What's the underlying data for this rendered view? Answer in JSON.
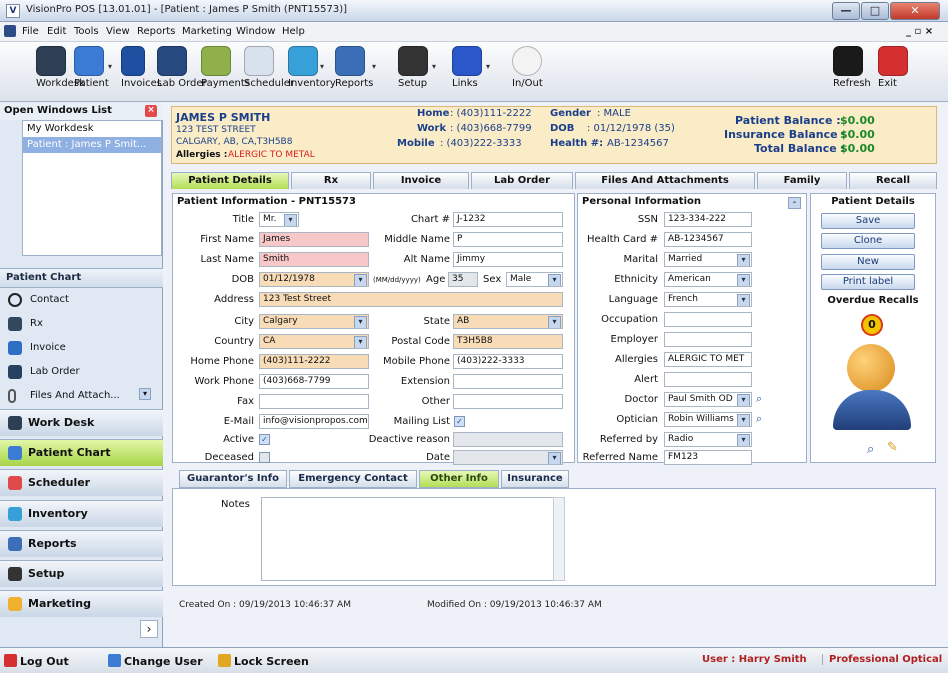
{
  "window": {
    "title": "VisionPro POS   [13.01.01] - [Patient : James P Smith (PNT15573)]",
    "logo": "V",
    "min": "—",
    "max": "□",
    "close": "✕"
  },
  "menu": {
    "items": [
      "File",
      "Edit",
      "Tools",
      "View",
      "Reports",
      "Marketing",
      "Window",
      "Help"
    ],
    "controls": "_ ▫ ×"
  },
  "toolbar": {
    "items": [
      {
        "label": "Workdesk",
        "icon": "workdesk-icon",
        "color": "#2e3f55"
      },
      {
        "label": "Patient",
        "icon": "patient-icon",
        "color": "#3b7bd4"
      },
      {
        "label": "Invoices",
        "icon": "invoices-icon",
        "color": "#1f4fa0"
      },
      {
        "label": "Lab Order",
        "icon": "lab-order-icon",
        "color": "#264a7f"
      },
      {
        "label": "Payments",
        "icon": "payments-icon",
        "color": "#8fb04a"
      },
      {
        "label": "Scheduler",
        "icon": "scheduler-icon",
        "color": "#d8e2ef"
      },
      {
        "label": "Inventory",
        "icon": "inventory-icon",
        "color": "#38a0d8"
      },
      {
        "label": "Reports",
        "icon": "reports-icon",
        "color": "#3a6fb8"
      },
      {
        "label": "Setup",
        "icon": "setup-icon",
        "color": "#333333"
      },
      {
        "label": "Links",
        "icon": "links-icon",
        "color": "#2a57c9"
      },
      {
        "label": "In/Out",
        "icon": "in-out-icon",
        "color": "#f3f3f3"
      },
      {
        "label": "Refresh",
        "icon": "refresh-icon",
        "color": "#1a1a1a"
      },
      {
        "label": "Exit",
        "icon": "exit-icon",
        "color": "#d43030"
      }
    ],
    "dropdown": "▾"
  },
  "left": {
    "open_windows_title": "Open Windows List",
    "open_windows": [
      "My Workdesk",
      "Patient : James P Smit..."
    ],
    "patient_chart_title": "Patient Chart",
    "chart_items": [
      {
        "label": "Contact",
        "icon": "contact-icon"
      },
      {
        "label": "Rx",
        "icon": "rx-icon"
      },
      {
        "label": "Invoice",
        "icon": "invoice-icon"
      },
      {
        "label": "Lab Order",
        "icon": "lab-order-icon"
      },
      {
        "label": "Files And Attach...",
        "icon": "paperclip-icon"
      }
    ],
    "nav": [
      {
        "label": "Work Desk",
        "icon": "workdesk-icon"
      },
      {
        "label": "Patient Chart",
        "icon": "patient-chart-icon"
      },
      {
        "label": "Scheduler",
        "icon": "scheduler-icon"
      },
      {
        "label": "Inventory",
        "icon": "inventory-icon"
      },
      {
        "label": "Reports",
        "icon": "reports-icon"
      },
      {
        "label": "Setup",
        "icon": "setup-icon"
      },
      {
        "label": "Marketing",
        "icon": "marketing-icon"
      }
    ],
    "expand": "›"
  },
  "header": {
    "name": "JAMES P SMITH",
    "street": "123 TEST STREET",
    "city": "CALGARY, AB, CA,T3H5B8",
    "allergies_label": "Allergies :",
    "allergies_value": "ALERGIC TO METAL",
    "home_label": "Home",
    "home": ": (403)111-2222",
    "work_label": "Work",
    "work": ": (403)668-7799",
    "mobile_label": "Mobile",
    "mobile": ": (403)222-3333",
    "gender_label": "Gender",
    "gender": ": MALE",
    "dob_label": "DOB",
    "dob": ": 01/12/1978 (35)",
    "health_label": "Health #:",
    "health": "AB-1234567",
    "patient_balance_label": "Patient Balance :",
    "patient_balance": "$0.00",
    "insurance_balance_label": "Insurance Balance :",
    "insurance_balance": "$0.00",
    "total_balance_label": "Total Balance :",
    "total_balance": "$0.00"
  },
  "tabs": [
    "Patient Details",
    "Rx",
    "Invoice",
    "Lab Order",
    "Files And Attachments",
    "Family",
    "Recall"
  ],
  "patient_info": {
    "title": "Patient Information - PNT15573",
    "title_label": "Title",
    "title_value": "Mr.",
    "chart_label": "Chart #",
    "chart_value": "J-1232",
    "first_label": "First Name",
    "first_value": "James",
    "middle_label": "Middle Name",
    "middle_value": "P",
    "last_label": "Last Name",
    "last_value": "Smith",
    "alt_label": "Alt Name",
    "alt_value": "Jimmy",
    "dob_label": "DOB",
    "dob_value": "01/12/1978",
    "dob_format": "(MM/dd/yyyy)",
    "age_label": "Age",
    "age_value": "35",
    "sex_label": "Sex",
    "sex_value": "Male",
    "address_label": "Address",
    "address_value": "123 Test Street",
    "city_label": "City",
    "city_value": "Calgary",
    "state_label": "State",
    "state_value": "AB",
    "country_label": "Country",
    "country_value": "CA",
    "postal_label": "Postal Code",
    "postal_value": "T3H5B8",
    "homephone_label": "Home Phone",
    "homephone_value": "(403)111-2222",
    "mobilephone_label": "Mobile Phone",
    "mobilephone_value": "(403)222-3333",
    "workphone_label": "Work  Phone",
    "workphone_value": "(403)668-7799",
    "extension_label": "Extension",
    "extension_value": "",
    "fax_label": "Fax",
    "fax_value": "",
    "other_label": "Other",
    "other_value": "",
    "email_label": "E-Mail",
    "email_value": "info@visionpropos.com",
    "mailing_label": "Mailing List",
    "active_label": "Active",
    "deactive_label": "Deactive reason",
    "deceased_label": "Deceased",
    "date_label": "Date"
  },
  "personal": {
    "title": "Personal Information",
    "collapse": "-",
    "ssn_label": "SSN",
    "ssn": "123-334-222",
    "hc_label": "Health Card #",
    "hc": "AB-1234567",
    "marital_label": "Marital",
    "marital": "Married",
    "ethnicity_label": "Ethnicity",
    "ethnicity": "American",
    "language_label": "Language",
    "language": "French",
    "occupation_label": "Occupation",
    "occupation": "",
    "employer_label": "Employer",
    "employer": "",
    "allergies_label": "Allergies",
    "allergies": "ALERGIC TO MET",
    "alert_label": "Alert",
    "alert": "",
    "doctor_label": "Doctor",
    "doctor": "Paul Smith OD",
    "optician_label": "Optician",
    "optician": "Robin Williams",
    "referredby_label": "Referred by",
    "referredby": "Radio",
    "referredname_label": "Referred Name",
    "referredname": "FM123"
  },
  "details": {
    "title": "Patient Details",
    "buttons": [
      "Save",
      "Clone",
      "New",
      "Print label"
    ],
    "overdue_label": "Overdue Recalls",
    "overdue_count": "0",
    "accent": "#1f5fbf"
  },
  "subtabs": [
    "Guarantor's Info",
    "Emergency Contact",
    "Other Info",
    "Insurance"
  ],
  "notes": {
    "label": "Notes",
    "value": ""
  },
  "footer": {
    "created": "Created On : 09/19/2013 10:46:37 AM",
    "modified": "Modified On :  09/19/2013 10:46:37 AM"
  },
  "status": {
    "logout": "Log Out",
    "change_user": "Change User",
    "lock": "Lock Screen",
    "user": "User : Harry Smith",
    "company": "Professional Optical"
  }
}
